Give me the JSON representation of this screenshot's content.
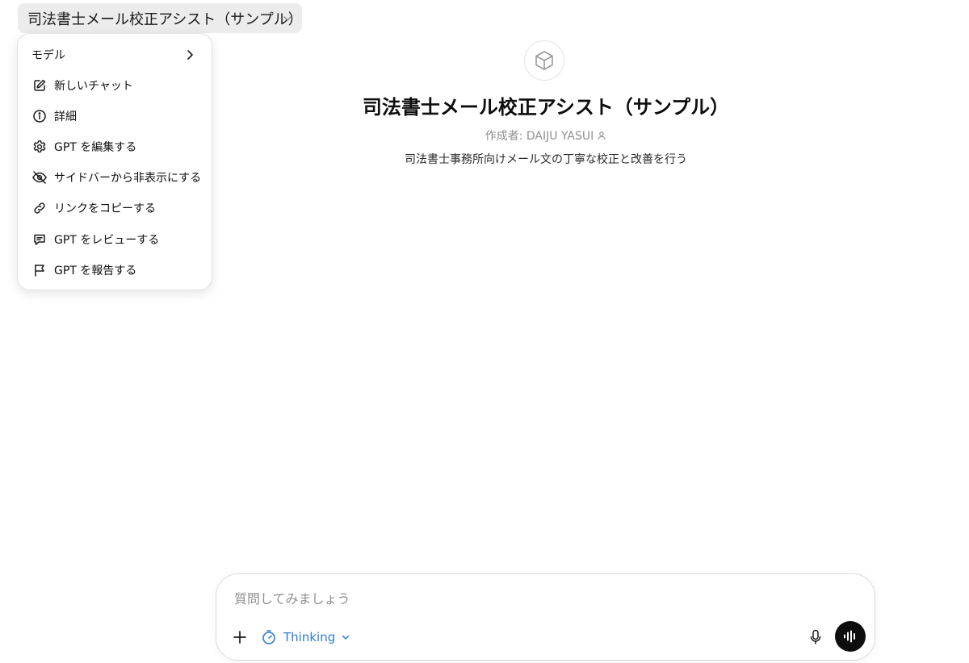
{
  "header": {
    "gpt_title": "司法書士メール校正アシスト（サンプル）"
  },
  "menu": {
    "items": [
      {
        "label": "モデル",
        "icon": "chevron-right-icon"
      },
      {
        "label": "新しいチャット",
        "icon": "edit-icon"
      },
      {
        "label": "詳細",
        "icon": "info-icon"
      },
      {
        "label": "GPT を編集する",
        "icon": "gear-icon"
      },
      {
        "label": "サイドバーから非表示にする",
        "icon": "eye-off-icon"
      },
      {
        "label": "リンクをコピーする",
        "icon": "link-icon"
      },
      {
        "label": "GPT をレビューする",
        "icon": "review-icon"
      },
      {
        "label": "GPT を報告する",
        "icon": "flag-icon"
      }
    ]
  },
  "profile": {
    "name": "司法書士メール校正アシスト（サンプル）",
    "author": "作成者: DAIJU YASUI",
    "description": "司法書士事務所向けメール文の丁寧な校正と改善を行う",
    "avatar_icon": "cube-icon"
  },
  "composer": {
    "placeholder": "質問してみましょう",
    "mode_label": "Thinking",
    "accent_color": "#2f7bd7"
  }
}
